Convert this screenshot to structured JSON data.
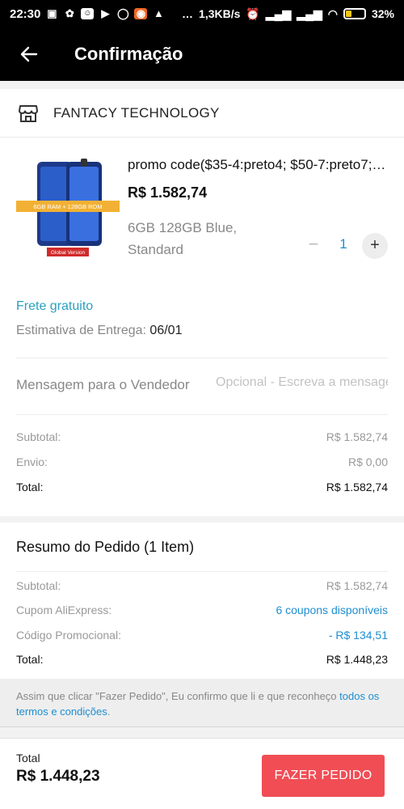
{
  "status_bar": {
    "time": "22:30",
    "net_speed": "1,3KB/s",
    "battery": "32%",
    "battery_level": 0.32
  },
  "header": {
    "title": "Confirmação",
    "back_icon": "arrow-left-icon"
  },
  "store": {
    "icon": "store-icon",
    "name": "FANTACY  TECHNOLOGY"
  },
  "product": {
    "thumbnail_badge": "6GB RAM + 128GB ROM",
    "thumbnail_footer": "Global Version",
    "name": "promo code($35-4:preto4; $50-7:preto7; ...)",
    "price": "R$ 1.582,74",
    "variant_line1": "6GB 128GB Blue,",
    "variant_line2": "Standard",
    "minus": "−",
    "quantity": "1",
    "plus": "+"
  },
  "shipping": {
    "free_label": "Frete gratuito",
    "estimate_label": "Estimativa de Entrega: ",
    "estimate_date": "06/01"
  },
  "message": {
    "label": "Mensagem para o Vendedor",
    "placeholder": "Opcional - Escreva a mensagem"
  },
  "store_totals": [
    {
      "label": "Subtotal:",
      "value": "R$ 1.582,74"
    },
    {
      "label": "Envio:",
      "value": "R$ 0,00"
    },
    {
      "label": "Total:",
      "value": "R$ 1.582,74"
    }
  ],
  "summary": {
    "heading": "Resumo do Pedido (1 Item)",
    "rows": [
      {
        "label": "Subtotal:",
        "value": "R$ 1.582,74"
      },
      {
        "label": "Cupom AliExpress:",
        "value": "6 coupons disponíveis"
      },
      {
        "label": "Código Promocional:",
        "value": "- R$ 134,51"
      },
      {
        "label": "Total:",
        "value": "R$ 1.448,23"
      }
    ]
  },
  "terms": {
    "text": "Assim que clicar \"Fazer Pedido\", Eu confirmo que li e que reconheço ",
    "link": "todos os termos e condições",
    "end": "."
  },
  "bottom": {
    "total_label": "Total",
    "total_value": "R$ 1.448,23",
    "order_button": "FAZER PEDIDO"
  },
  "colors": {
    "accent_blue": "#1f8ed1",
    "free_shipping": "#2aa0c0",
    "order_button": "#f04d55"
  }
}
